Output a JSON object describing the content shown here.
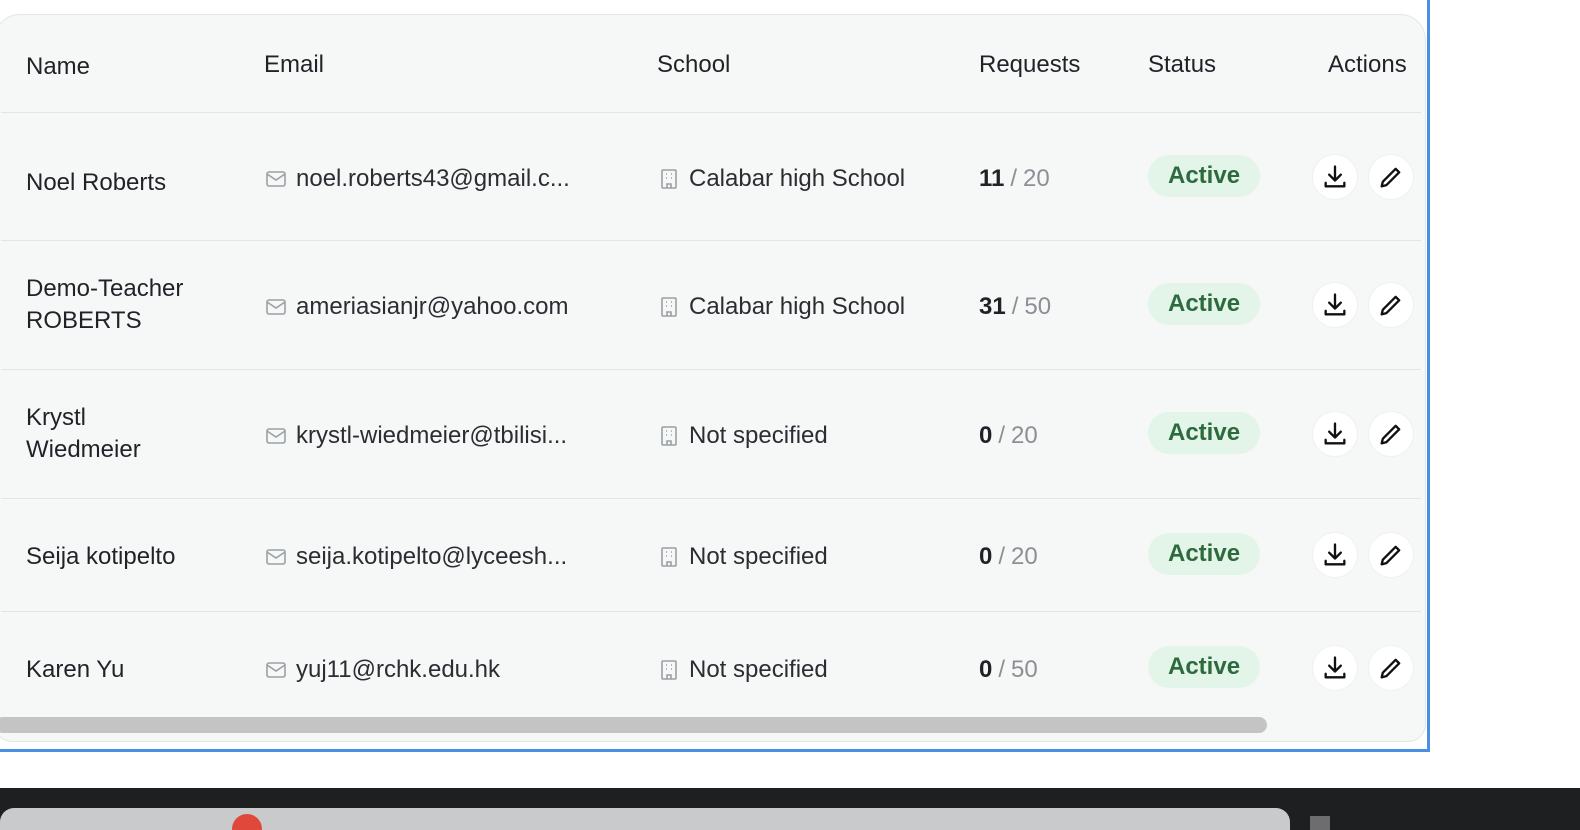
{
  "table": {
    "headers": {
      "name": "Name",
      "email": "Email",
      "school": "School",
      "requests": "Requests",
      "status": "Status",
      "actions": "Actions"
    },
    "rows": [
      {
        "name": "Noel Roberts",
        "email": "noel.roberts43@gmail.c...",
        "school": "Calabar high School",
        "requests_used": "11",
        "requests_total": "20",
        "status": "Active"
      },
      {
        "name": "Demo-Teacher ROBERTS",
        "email": "ameriasianjr@yahoo.com",
        "school": "Calabar high School",
        "requests_used": "31",
        "requests_total": "50",
        "status": "Active"
      },
      {
        "name": "Krystl Wiedmeier",
        "email": "krystl-wiedmeier@tbilisi...",
        "school": "Not specified",
        "requests_used": "0",
        "requests_total": "20",
        "status": "Active"
      },
      {
        "name": "Seija kotipelto",
        "email": "seija.kotipelto@lyceesh...",
        "school": "Not specified",
        "requests_used": "0",
        "requests_total": "20",
        "status": "Active"
      },
      {
        "name": "Karen Yu",
        "email": "yuj11@rchk.edu.hk",
        "school": "Not specified",
        "requests_used": "0",
        "requests_total": "50",
        "status": "Active"
      }
    ],
    "request_separator": "/",
    "icons": {
      "email": "mail-icon",
      "school": "building-icon",
      "download": "download-icon",
      "edit": "pencil-icon"
    }
  },
  "colors": {
    "status_active_bg": "#e3f5e8",
    "status_active_text": "#2d6a3e",
    "focus_frame": "#4a90e2"
  }
}
